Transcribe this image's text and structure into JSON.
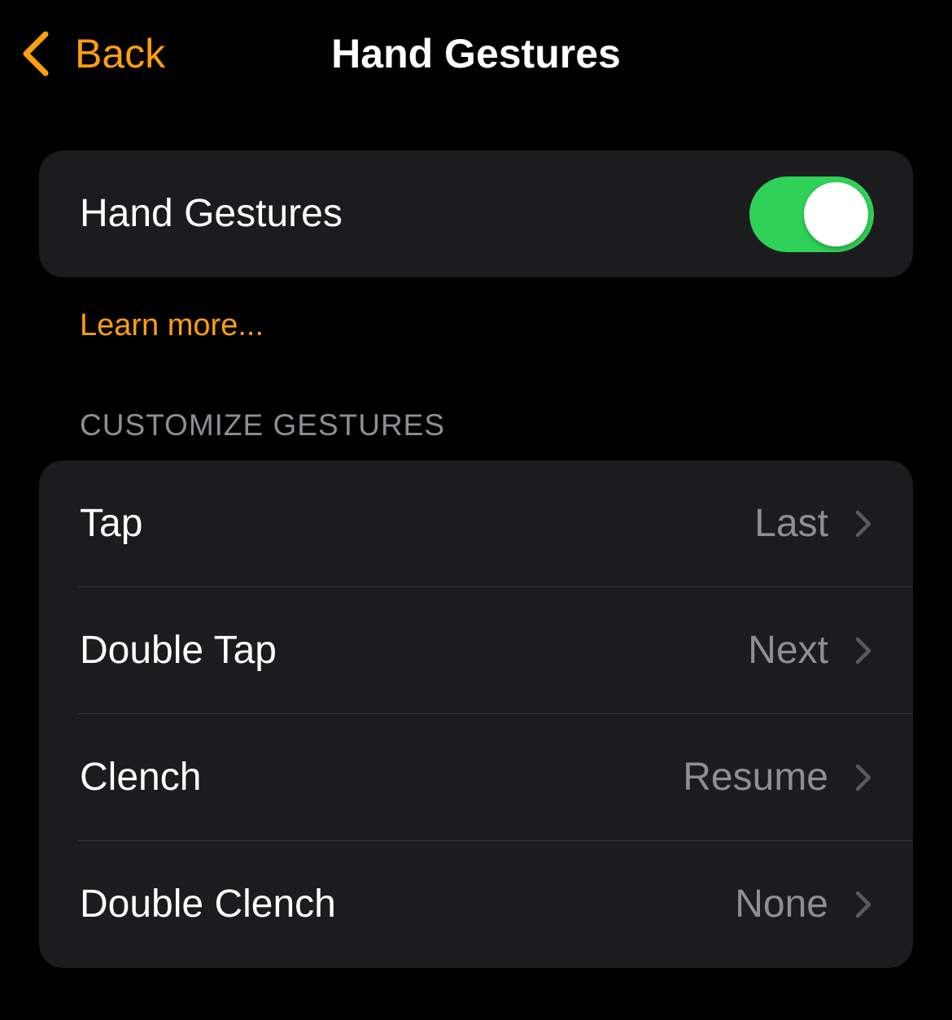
{
  "nav": {
    "back_label": "Back",
    "title": "Hand Gestures"
  },
  "main_toggle": {
    "label": "Hand Gestures",
    "enabled": true
  },
  "learn_more": "Learn more...",
  "section_header": "CUSTOMIZE GESTURES",
  "gestures": [
    {
      "label": "Tap",
      "value": "Last"
    },
    {
      "label": "Double Tap",
      "value": "Next"
    },
    {
      "label": "Clench",
      "value": "Resume"
    },
    {
      "label": "Double Clench",
      "value": "None"
    }
  ],
  "colors": {
    "accent": "#ff9f0a",
    "toggle_on": "#30d158",
    "background": "#000000",
    "card": "#1c1c1e",
    "secondary_text": "#8e8e93"
  },
  "icons": {
    "back": "chevron-left-icon",
    "row_disclosure": "chevron-right-icon"
  }
}
